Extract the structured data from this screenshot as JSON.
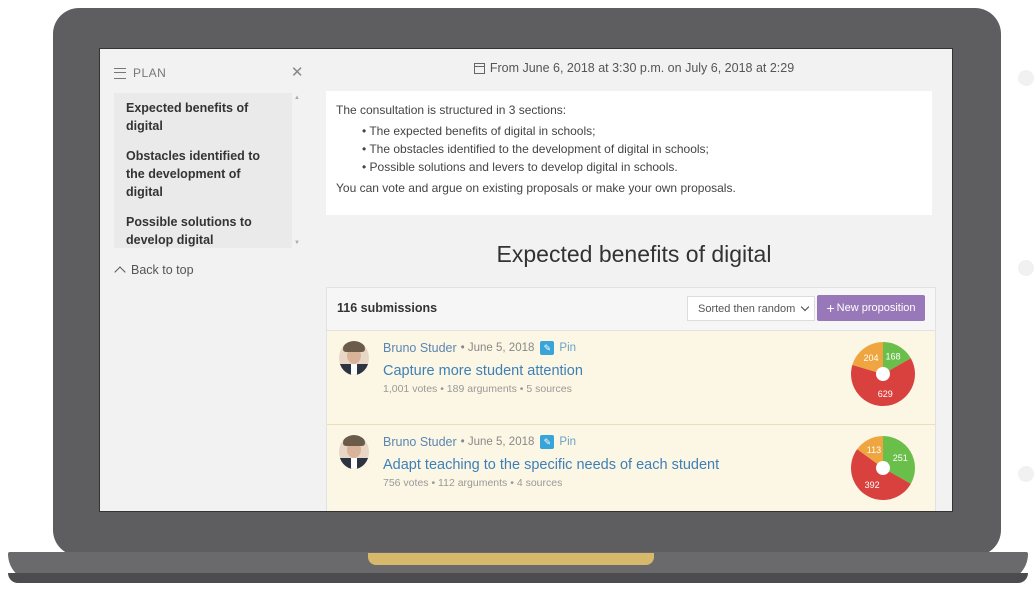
{
  "sidebar": {
    "plan_label": "PLAN",
    "items": [
      {
        "label": "Expected benefits of digital"
      },
      {
        "label": "Obstacles identified to the development of digital"
      },
      {
        "label": "Possible solutions to develop digital"
      }
    ],
    "back_to_top": "Back to top"
  },
  "header": {
    "date_range": "From June 6, 2018 at 3:30 p.m. on July 6, 2018 at 2:29"
  },
  "intro": {
    "lead": "The consultation is structured in 3 sections:",
    "bullets": [
      "The expected benefits of digital in schools;",
      "The obstacles identified to the development of digital in schools;",
      "Possible solutions and levers to develop digital in schools."
    ],
    "footer": "You can vote and argue on existing proposals or make your own proposals."
  },
  "section": {
    "title": "Expected benefits of digital",
    "submissions": "116 submissions",
    "sort_value": "Sorted then random",
    "new_button": "New proposition"
  },
  "colors": {
    "agree": "#6abf4b",
    "mixed": "#f0a640",
    "disagree": "#d9413f",
    "accent": "#9878b8",
    "link": "#3d80b8"
  },
  "proposals": [
    {
      "author": "Bruno Studer",
      "date": "• June 5, 2018",
      "pin": "Pin",
      "title": "Capture more student attention",
      "stats": "1,001 votes • 189 arguments • 5 sources",
      "votes": {
        "agree": 168,
        "mixed": 204,
        "disagree": 629
      }
    },
    {
      "author": "Bruno Studer",
      "date": "• June 5, 2018",
      "pin": "Pin",
      "title": "Adapt teaching to the specific needs of each student",
      "stats": "756 votes • 112 arguments • 4 sources",
      "votes": {
        "agree": 251,
        "mixed": 113,
        "disagree": 392
      }
    }
  ]
}
